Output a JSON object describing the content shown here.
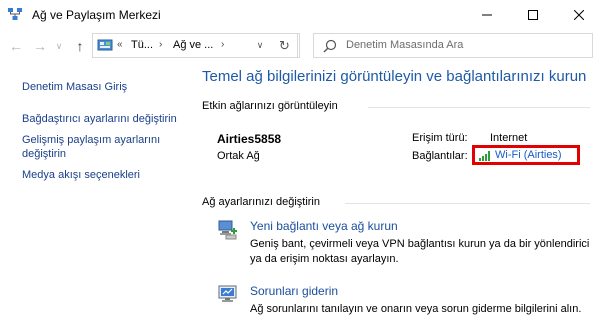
{
  "window": {
    "title": "Ağ ve Paylaşım Merkezi"
  },
  "address_bar": {
    "crumbs": [
      "Tü...",
      "Ağ ve ..."
    ],
    "search_placeholder": "Denetim Masasında Ara"
  },
  "sidebar": {
    "items": [
      {
        "label": "Denetim Masası Giriş"
      },
      {
        "label": "Bağdaştırıcı ayarlarını değiştirin"
      },
      {
        "label": "Gelişmiş paylaşım ayarlarını"
      },
      {
        "label": "değiştirin"
      },
      {
        "label": "Medya akışı seçenekleri"
      }
    ]
  },
  "main": {
    "title": "Temel ağ bilgilerinizi görüntüleyin ve bağlantılarınızı kurun",
    "active_networks_heading": "Etkin ağlarınızı görüntüleyin",
    "network": {
      "name": "Airties5858",
      "type": "Ortak Ağ",
      "access_label": "Erişim türü:",
      "access_value": "Internet",
      "connections_label": "Bağlantılar:",
      "connection_link": "Wi-Fi (Airties)"
    },
    "change_heading": "Ağ ayarlarınızı değiştirin",
    "tasks": [
      {
        "title": "Yeni bağlantı veya ağ kurun",
        "desc_line1": "Geniş bant, çevirmeli veya VPN bağlantısı kurun ya da bir yönlendirici",
        "desc_line2": "ya da erişim noktası ayarlayın."
      },
      {
        "title": "Sorunları giderin",
        "desc_line1": "Ağ sorunlarını tanılayın ve onarın veya sorun giderme bilgilerini alın."
      }
    ]
  },
  "colors": {
    "link": "#1a3f8a",
    "title": "#1e5aa7",
    "highlight": "#e20000"
  }
}
